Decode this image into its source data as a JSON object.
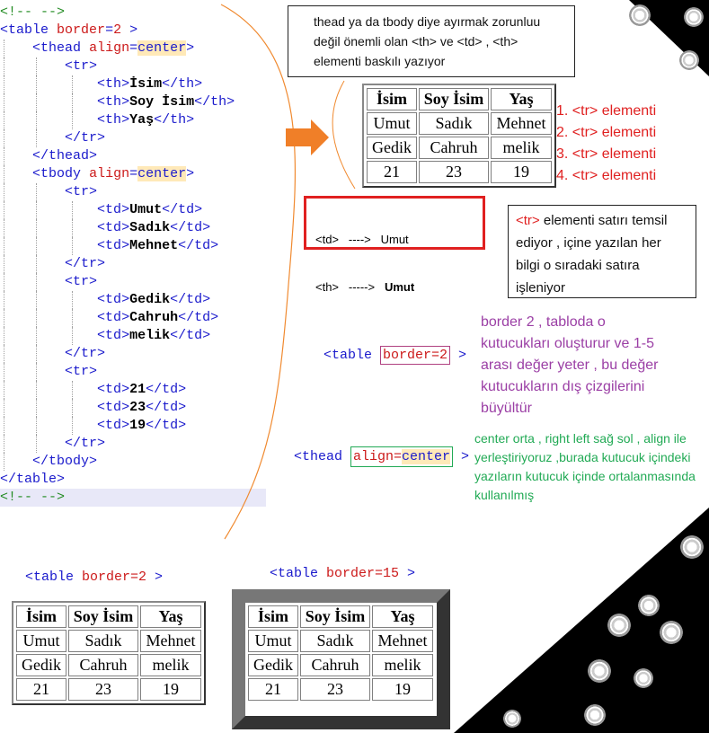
{
  "code": {
    "comment_open": "<!-- -->",
    "comment_close": "<!-- -->",
    "table_tag": "table",
    "table_attr": "border",
    "table_val": "2",
    "thead_tag": "thead",
    "tbody_tag": "tbody",
    "align_attr": "align",
    "center_val": "center",
    "tr_tag": "tr",
    "th_tag": "th",
    "td_tag": "td",
    "th_cells": [
      "İsim",
      "Soy İsim",
      "Yaş"
    ],
    "rows": [
      [
        "Umut",
        "Sadık",
        "Mehnet"
      ],
      [
        "Gedik",
        "Cahruh",
        "melik"
      ],
      [
        "21",
        "23",
        "19"
      ]
    ]
  },
  "table": {
    "headers": [
      "İsim",
      "Soy İsim",
      "Yaş"
    ],
    "rows": [
      [
        "Umut",
        "Sadık",
        "Mehnet"
      ],
      [
        "Gedik",
        "Cahruh",
        "melik"
      ],
      [
        "21",
        "23",
        "19"
      ]
    ]
  },
  "notes": {
    "top": "thead ya da tbody diye ayırmak zorunluu değil önemli olan <th> ve <td> , <th> elementi baskılı yazıyor",
    "tr_labels": [
      "1. <tr> elementi",
      "2. <tr> elementi",
      "3. <tr> elementi",
      "4. <tr> elementi"
    ],
    "compare_td": "<td>   ---->   Umut",
    "compare_th": "<th>   ----->   ",
    "compare_th_bold": "Umut",
    "tr_note_tag": "<tr>",
    "tr_note_rest": " elementi satırı temsil ediyor , içine yazılan her bilgi o sıradaki satıra işleniyor",
    "border_code_prefix": "<table ",
    "border_code_attr": "border=2",
    "border_code_suffix": " >",
    "border_note": "border 2 , tabloda o kutucukları oluşturur ve 1-5 arası değer yeter , bu değer kutucukların dış çizgilerini büyültür",
    "thead_code_prefix": "<thead ",
    "thead_code_attr": "align=",
    "thead_code_val": "center",
    "thead_code_suffix": " >",
    "center_note": "center orta , right left sağ sol , align ile yerleştiriyoruz ,burada kutucuk içindeki yazıların kutucuk içinde ortalanmasında kullanılmış",
    "label_border2_tag": "<table ",
    "label_border2_attr": "border=2",
    "label_border2_end": " >",
    "label_border15_tag": "<table ",
    "label_border15_attr": "border=15",
    "label_border15_end": " >"
  },
  "colors": {
    "tag": "#1a1acc",
    "attr": "#cc1a1a",
    "value_hl": "#ffe9b8",
    "tr_label": "#e02020",
    "border_note": "#9b3fa5",
    "center_note": "#22aa55",
    "arrow": "#f07f28",
    "red_box": "#e02020",
    "border15_frame": "#555555"
  }
}
